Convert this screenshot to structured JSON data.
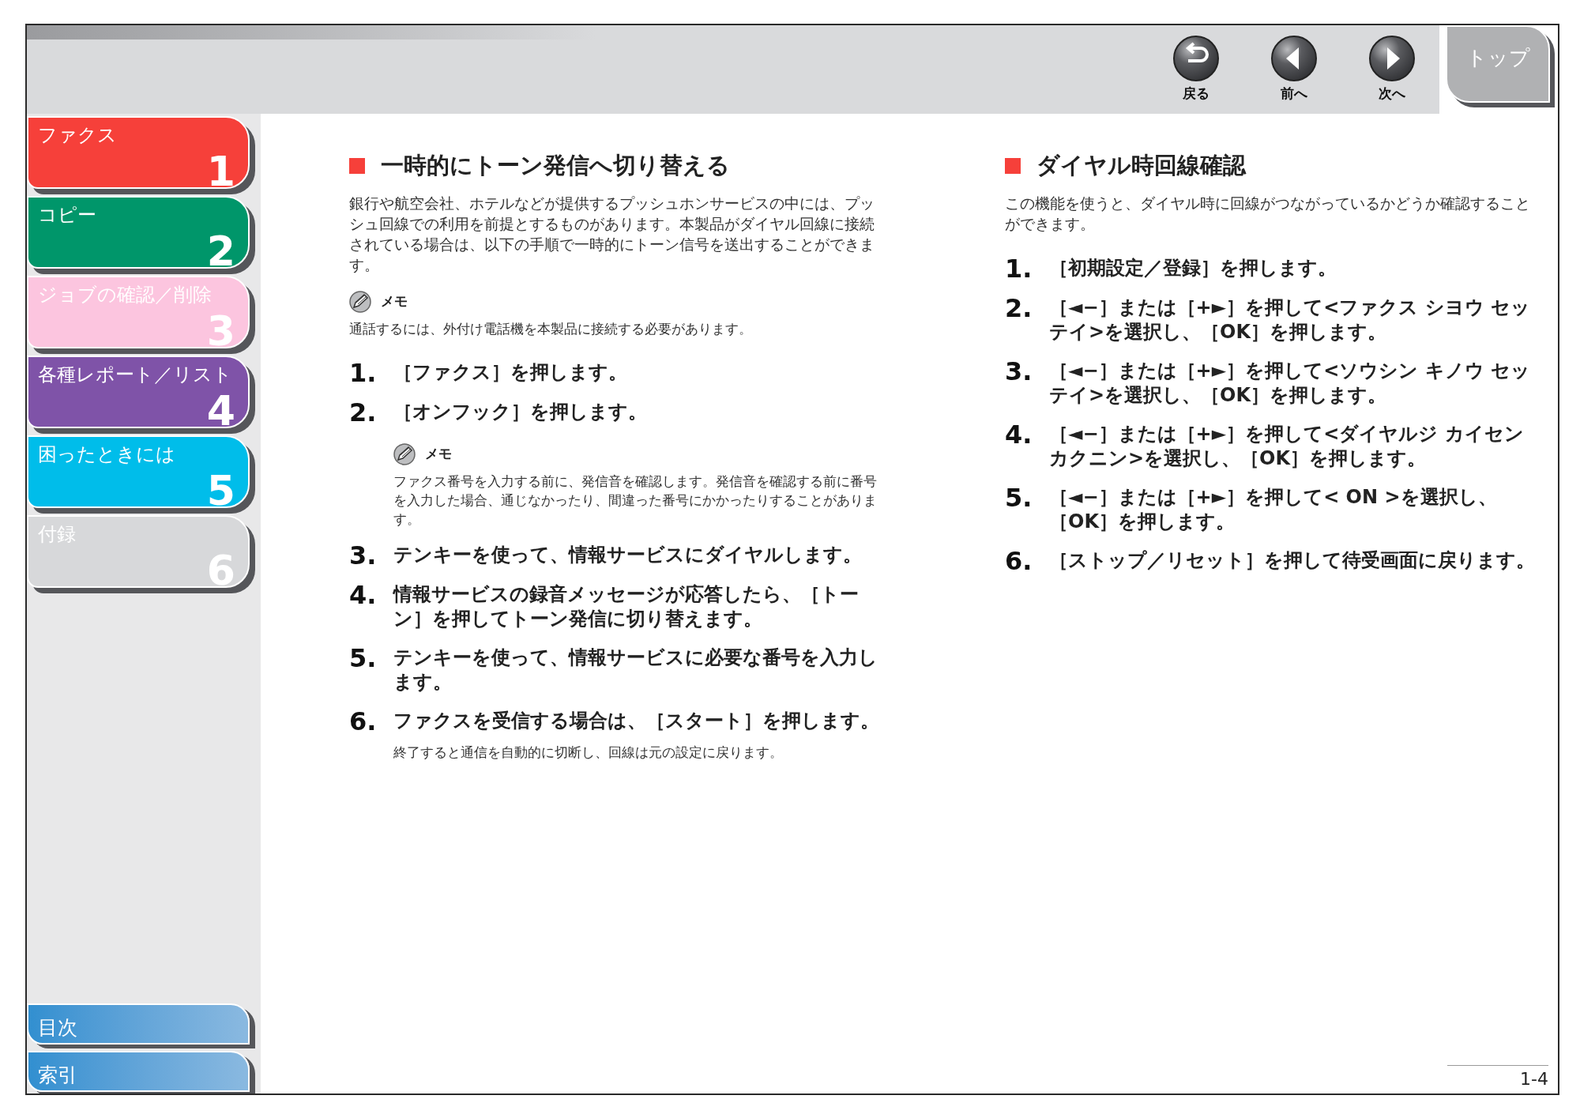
{
  "header": {
    "nav": [
      {
        "kind": "back",
        "label": "戻る"
      },
      {
        "kind": "prev",
        "label": "前へ"
      },
      {
        "kind": "next",
        "label": "次へ"
      }
    ],
    "top_tab": "トップ"
  },
  "sidebar": {
    "chapters": [
      {
        "label": "ファクス",
        "number": "1",
        "color": "#f6403a"
      },
      {
        "label": "コピー",
        "number": "2",
        "color": "#00966a"
      },
      {
        "label": "ジョブの確認／削除",
        "number": "3",
        "color": "#fcc5df"
      },
      {
        "label": "各種レポート／リスト",
        "number": "4",
        "color": "#7f53a8"
      },
      {
        "label": "困ったときには",
        "number": "5",
        "color": "#00bdea"
      },
      {
        "label": "付録",
        "number": "6",
        "color": "#d7d8da"
      }
    ],
    "links": [
      "目次",
      "索引"
    ]
  },
  "sections": [
    {
      "title": "一時的にトーン発信へ切り替える",
      "intro": "銀行や航空会社、ホテルなどが提供するプッシュホンサービスの中には、プッシュ回線での利用を前提とするものがあります。本製品がダイヤル回線に接続されている場合は、以下の手順で一時的にトーン信号を送出することができます。",
      "memo": {
        "label": "メモ",
        "text": "通話するには、外付け電話機を本製品に接続する必要があります。"
      },
      "steps": [
        {
          "number": "1.",
          "text": "［ファクス］を押します。"
        },
        {
          "number": "2.",
          "text": "［オンフック］を押します。",
          "memo": {
            "label": "メモ",
            "text": "ファクス番号を入力する前に、発信音を確認します。発信音を確認する前に番号を入力した場合、通じなかったり、間違った番号にかかったりすることがあります。"
          }
        },
        {
          "number": "3.",
          "text": "テンキーを使って、情報サービスにダイヤルします。"
        },
        {
          "number": "4.",
          "text": "情報サービスの録音メッセージが応答したら、［トーン］を押してトーン発信に切り替えます。"
        },
        {
          "number": "5.",
          "text": "テンキーを使って、情報サービスに必要な番号を入力します。"
        },
        {
          "number": "6.",
          "text": "ファクスを受信する場合は、［スタート］を押します。",
          "note": "終了すると通信を自動的に切断し、回線は元の設定に戻ります。"
        }
      ]
    },
    {
      "title": "ダイヤル時回線確認",
      "intro": "この機能を使うと、ダイヤル時に回線がつながっているかどうか確認することができます。",
      "steps": [
        {
          "number": "1.",
          "text": "［初期設定／登録］を押します。"
        },
        {
          "number": "2.",
          "text": "［◄−］または［+►］を押して<ファクス シヨウ セッテイ>を選択し、［OK］を押します。"
        },
        {
          "number": "3.",
          "text": "［◄−］または［+►］を押して<ソウシン キノウ セッテイ>を選択し、［OK］を押します。"
        },
        {
          "number": "4.",
          "text": "［◄−］または［+►］を押して<ダイヤルジ カイセンカクニン>を選択し、［OK］を押します。"
        },
        {
          "number": "5.",
          "text": "［◄−］または［+►］を押して< ON >を選択し、［OK］を押します。"
        },
        {
          "number": "6.",
          "text": "［ストップ／リセット］を押して待受画面に戻ります。"
        }
      ]
    }
  ],
  "page_number": "1-4"
}
